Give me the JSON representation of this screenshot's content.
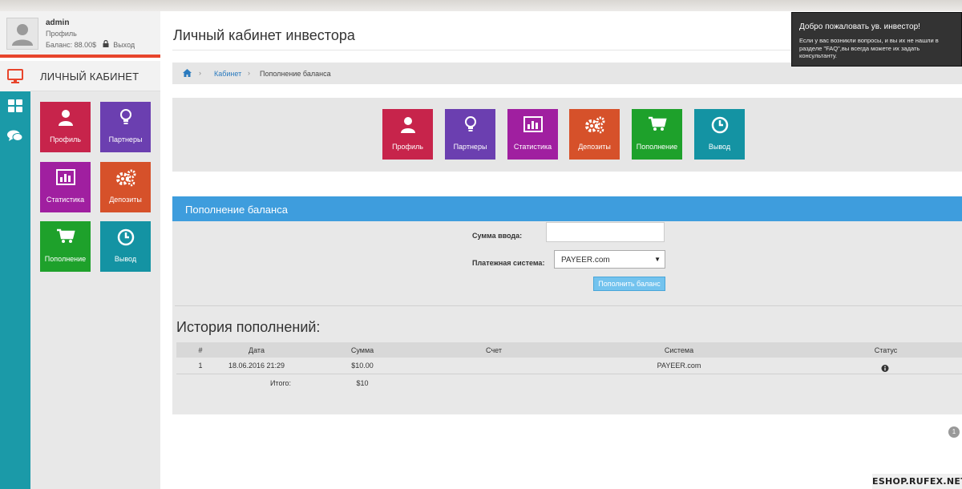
{
  "user": {
    "name": "admin",
    "role": "Профиль",
    "balance": "Баланс: 88.00$",
    "logout": "Выход"
  },
  "sidebar": {
    "title": "ЛИЧНЫЙ КАБИНЕТ",
    "rail_icons": [
      "monitor-icon",
      "grid-icon",
      "chat-icon"
    ],
    "tiles": [
      {
        "label": "Профиль",
        "icon": "user-icon",
        "color": "#c7244b"
      },
      {
        "label": "Партнеры",
        "icon": "lightbulb-icon",
        "color": "#6b3fb0"
      },
      {
        "label": "Статистика",
        "icon": "bar-chart-icon",
        "color": "#a01fa0"
      },
      {
        "label": "Депозиты",
        "icon": "gears-icon",
        "color": "#d6512a"
      },
      {
        "label": "Пополнение",
        "icon": "cart-icon",
        "color": "#1ea12b"
      },
      {
        "label": "Вывод",
        "icon": "clock-icon",
        "color": "#1493a3"
      }
    ]
  },
  "page": {
    "title": "Личный кабинет инвестора"
  },
  "breadcrumb": {
    "link": "Кабинет",
    "current": "Пополнение баланса"
  },
  "top_tiles": [
    {
      "label": "Профиль",
      "icon": "user-icon",
      "color": "#c7244b"
    },
    {
      "label": "Партнеры",
      "icon": "lightbulb-icon",
      "color": "#6b3fb0"
    },
    {
      "label": "Статистика",
      "icon": "bar-chart-icon",
      "color": "#a01fa0"
    },
    {
      "label": "Депозиты",
      "icon": "gears-icon",
      "color": "#d6512a"
    },
    {
      "label": "Пополнение",
      "icon": "cart-icon",
      "color": "#1ea12b"
    },
    {
      "label": "Вывод",
      "icon": "clock-icon",
      "color": "#1493a3"
    }
  ],
  "deposit_form": {
    "header": "Пополнение баланса",
    "amount_label": "Сумма ввода:",
    "amount_value": "",
    "system_label": "Платежная система:",
    "system_selected": "PAYEER.com",
    "submit_label": "Пополнить баланс"
  },
  "history": {
    "title": "История пополнений:",
    "columns": [
      "#",
      "Дата",
      "Сумма",
      "Счет",
      "Система",
      "Статус"
    ],
    "rows": [
      {
        "num": "1",
        "date": "18.06.2016 21:29",
        "amount": "$10.00",
        "account": "",
        "system": "PAYEER.com",
        "status_icon": "info-icon"
      }
    ],
    "total_label": "Итого:",
    "total_value": "$10"
  },
  "notification": {
    "title": "Добро пожаловать ув. инвестор!",
    "text": "Если у вас возникли вопросы, и вы их не нашли в разделе \"FAQ\",вы всегда можете их задать консультанту."
  },
  "pagination": {
    "badge": "1"
  },
  "watermark": "ESHOP.RUFEX.NET",
  "colors": {
    "accent_red": "#e8452c",
    "rail_teal": "#1b9aa8",
    "panel_blue": "#3e9ddd",
    "button_blue": "#73c3ee"
  }
}
